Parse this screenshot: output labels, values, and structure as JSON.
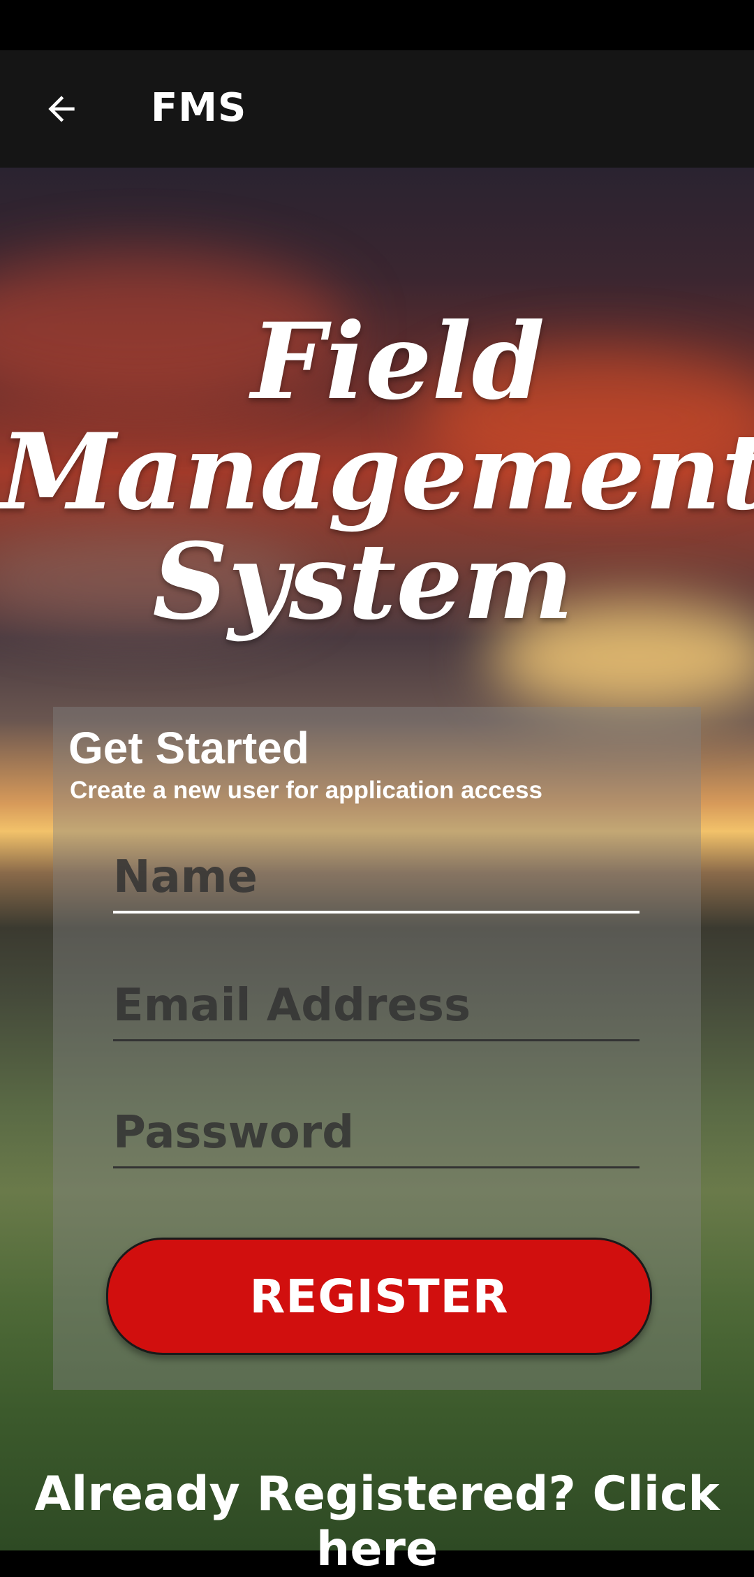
{
  "app_bar": {
    "title": "FMS",
    "back_icon": "arrow-left-icon"
  },
  "logo": {
    "line1": "Field",
    "line2": "Management",
    "line3": "System"
  },
  "card": {
    "title": "Get Started",
    "subtitle": "Create a new user for application access",
    "name_placeholder": "Name",
    "email_placeholder": "Email Address",
    "password_placeholder": "Password",
    "register_label": "REGISTER"
  },
  "footer": {
    "link_text": "Already Registered? Click here"
  },
  "colors": {
    "accent": "#d10f0e",
    "app_bar": "#151515"
  }
}
